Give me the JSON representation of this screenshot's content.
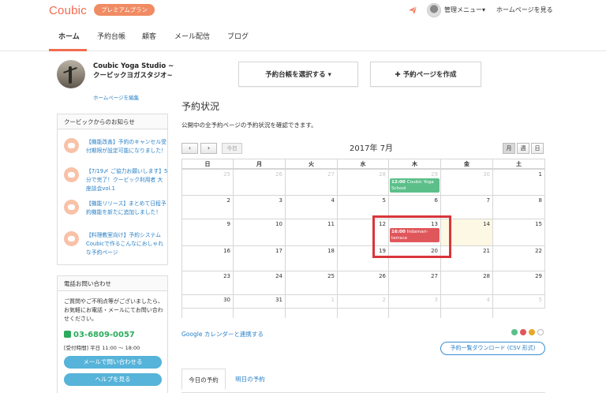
{
  "header": {
    "logo": "Coubic",
    "plan_badge": "プレミアムプラン",
    "admin_menu": "管理メニュー▾",
    "view_homepage": "ホームページを見る"
  },
  "nav": {
    "items": [
      {
        "label": "ホーム",
        "active": true
      },
      {
        "label": "予約台帳"
      },
      {
        "label": "顧客"
      },
      {
        "label": "メール配信"
      },
      {
        "label": "ブログ"
      }
    ],
    "accent_color": "#f26b4f"
  },
  "profile": {
    "name": "Coubic Yoga Studio ~クービックヨガスタジオ~",
    "edit_link": "ホームページを編集"
  },
  "notices": {
    "title": "クービックからのお知らせ",
    "items": [
      {
        "text": "【機能改善】予約のキャンセル受付期限が設定可能になりました！"
      },
      {
        "text": "【7/19〆 ご協力お願いします】5分で完了！クービック利用者 大座談会vol.1"
      },
      {
        "text": "【機能リリース】まとめて日程予約機能を新たに追加しました！"
      },
      {
        "text": "【料理教室向け】予約システムCoubicで作るこんなにおしゃれな予約ページ"
      }
    ]
  },
  "contact": {
    "title": "電話お問い合わせ",
    "description": "ご質問やご不明点等がございましたら、お気軽にお電話・メールにてお問い合わせください。",
    "phone": "03-6809-0057",
    "hours": "[受付時間] 平日 11:00 〜 18:00",
    "email_button": "メールで問い合わせる",
    "help_button": "ヘルプを見る"
  },
  "actions": {
    "select_ledger": "予約台帳を選択する ▾",
    "create_page": "✚ 予約ページを作成"
  },
  "status": {
    "title": "予約状況",
    "subtitle": "公開中の全予約ページの予約状況を確認できます。"
  },
  "calendar": {
    "prev": "‹",
    "next": "›",
    "today_button": "今日",
    "month_label": "2017年 7月",
    "views": [
      {
        "label": "月",
        "active": true
      },
      {
        "label": "週"
      },
      {
        "label": "日"
      }
    ],
    "weekdays": [
      "日",
      "月",
      "火",
      "水",
      "木",
      "金",
      "土"
    ],
    "weeks": [
      [
        {
          "d": "25",
          "o": true
        },
        {
          "d": "26",
          "o": true
        },
        {
          "d": "27",
          "o": true
        },
        {
          "d": "28",
          "o": true
        },
        {
          "d": "29",
          "o": true
        },
        {
          "d": "30",
          "o": true
        },
        {
          "d": "1"
        }
      ],
      [
        {
          "d": "2"
        },
        {
          "d": "3"
        },
        {
          "d": "4"
        },
        {
          "d": "5"
        },
        {
          "d": "6"
        },
        {
          "d": "7"
        },
        {
          "d": "8"
        }
      ],
      [
        {
          "d": "9"
        },
        {
          "d": "10"
        },
        {
          "d": "11"
        },
        {
          "d": "12"
        },
        {
          "d": "13"
        },
        {
          "d": "14",
          "today": true
        },
        {
          "d": "15"
        }
      ],
      [
        {
          "d": "16"
        },
        {
          "d": "17"
        },
        {
          "d": "18"
        },
        {
          "d": "19"
        },
        {
          "d": "20"
        },
        {
          "d": "21"
        },
        {
          "d": "22"
        }
      ],
      [
        {
          "d": "23"
        },
        {
          "d": "24"
        },
        {
          "d": "25"
        },
        {
          "d": "26"
        },
        {
          "d": "27"
        },
        {
          "d": "28"
        },
        {
          "d": "29"
        }
      ],
      [
        {
          "d": "30"
        },
        {
          "d": "31"
        },
        {
          "d": "1",
          "o": true
        },
        {
          "d": "2",
          "o": true
        },
        {
          "d": "3",
          "o": true
        },
        {
          "d": "4",
          "o": true
        },
        {
          "d": "5",
          "o": true
        }
      ]
    ],
    "events": [
      {
        "week": 0,
        "day": 4,
        "time": "12:00",
        "title": "Coubic Yoga School",
        "color": "#5cbf8a"
      },
      {
        "week": 2,
        "day": 4,
        "time": "16:00",
        "title": "hidamari-terrace",
        "color": "#e0575b"
      }
    ],
    "highlight_color": "#d9353b",
    "google_link": "Google カレンダーと連携する",
    "legend_colors": [
      "#5cbf8a",
      "#e0575b",
      "#e6a829",
      "#ffffff"
    ],
    "csv_button": "予約一覧ダウンロード (CSV 形式)"
  },
  "tabs": [
    {
      "label": "今日の予約",
      "active": true
    },
    {
      "label": "明日の予約"
    }
  ]
}
